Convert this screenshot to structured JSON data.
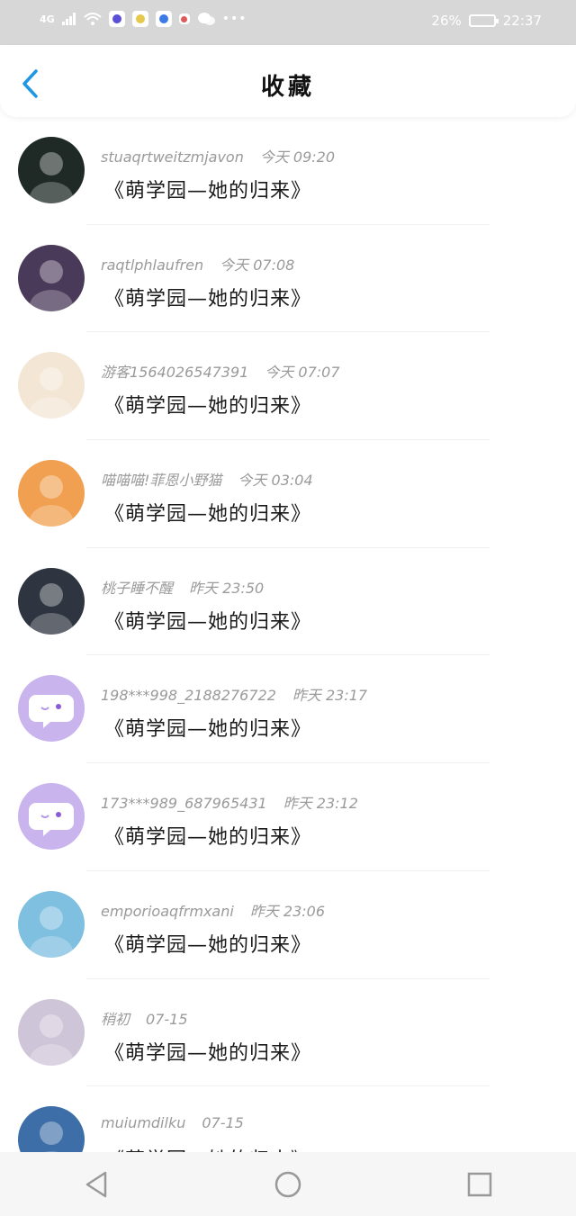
{
  "status_bar": {
    "network": "4G",
    "battery": "26%",
    "time": "22:37",
    "icons": [
      "signal-icon",
      "wifi-icon",
      "app-icon",
      "app-icon",
      "app-icon",
      "app-icon",
      "wechat-icon",
      "more-icon",
      "battery-icon"
    ]
  },
  "header": {
    "title": "收藏",
    "back_icon": "chevron-left-icon",
    "accent": "#1e96e6"
  },
  "items": [
    {
      "user": "stuaqrtweitzmjavon",
      "time": "今天 09:20",
      "title": "《萌学园—她的归来》",
      "avatar_color": "#1f2a26"
    },
    {
      "user": "raqtlphlaufren",
      "time": "今天 07:08",
      "title": "《萌学园—她的归来》",
      "avatar_color": "#4a3a5a"
    },
    {
      "user": "游客1564026547391",
      "time": "今天 07:07",
      "title": "《萌学园—她的归来》",
      "avatar_color": "#f3e6d4"
    },
    {
      "user": "喵喵喵!菲恩小野猫",
      "time": "今天 03:04",
      "title": "《萌学园—她的归来》",
      "avatar_color": "#f0a050"
    },
    {
      "user": "桃子睡不醒",
      "time": "昨天 23:50",
      "title": "《萌学园—她的归来》",
      "avatar_color": "#2e3540"
    },
    {
      "user": "198***998_2188276722",
      "time": "昨天 23:17",
      "title": "《萌学园—她的归来》",
      "avatar_color": "#c9b4ee"
    },
    {
      "user": "173***989_687965431",
      "time": "昨天 23:12",
      "title": "《萌学园—她的归来》",
      "avatar_color": "#c9b4ee"
    },
    {
      "user": "emporioaqfrmxani",
      "time": "昨天 23:06",
      "title": "《萌学园—她的归来》",
      "avatar_color": "#7fbfe0"
    },
    {
      "user": "稍初",
      "time": "07-15",
      "title": "《萌学园—她的归来》",
      "avatar_color": "#cfc5d8"
    },
    {
      "user": "muiumdilku",
      "time": "07-15",
      "title": "《萌学园—她的归来》",
      "avatar_color": "#3d6ea8"
    }
  ],
  "bottom_nav": {
    "icons": [
      "back-triangle-icon",
      "home-circle-icon",
      "recents-square-icon"
    ]
  }
}
